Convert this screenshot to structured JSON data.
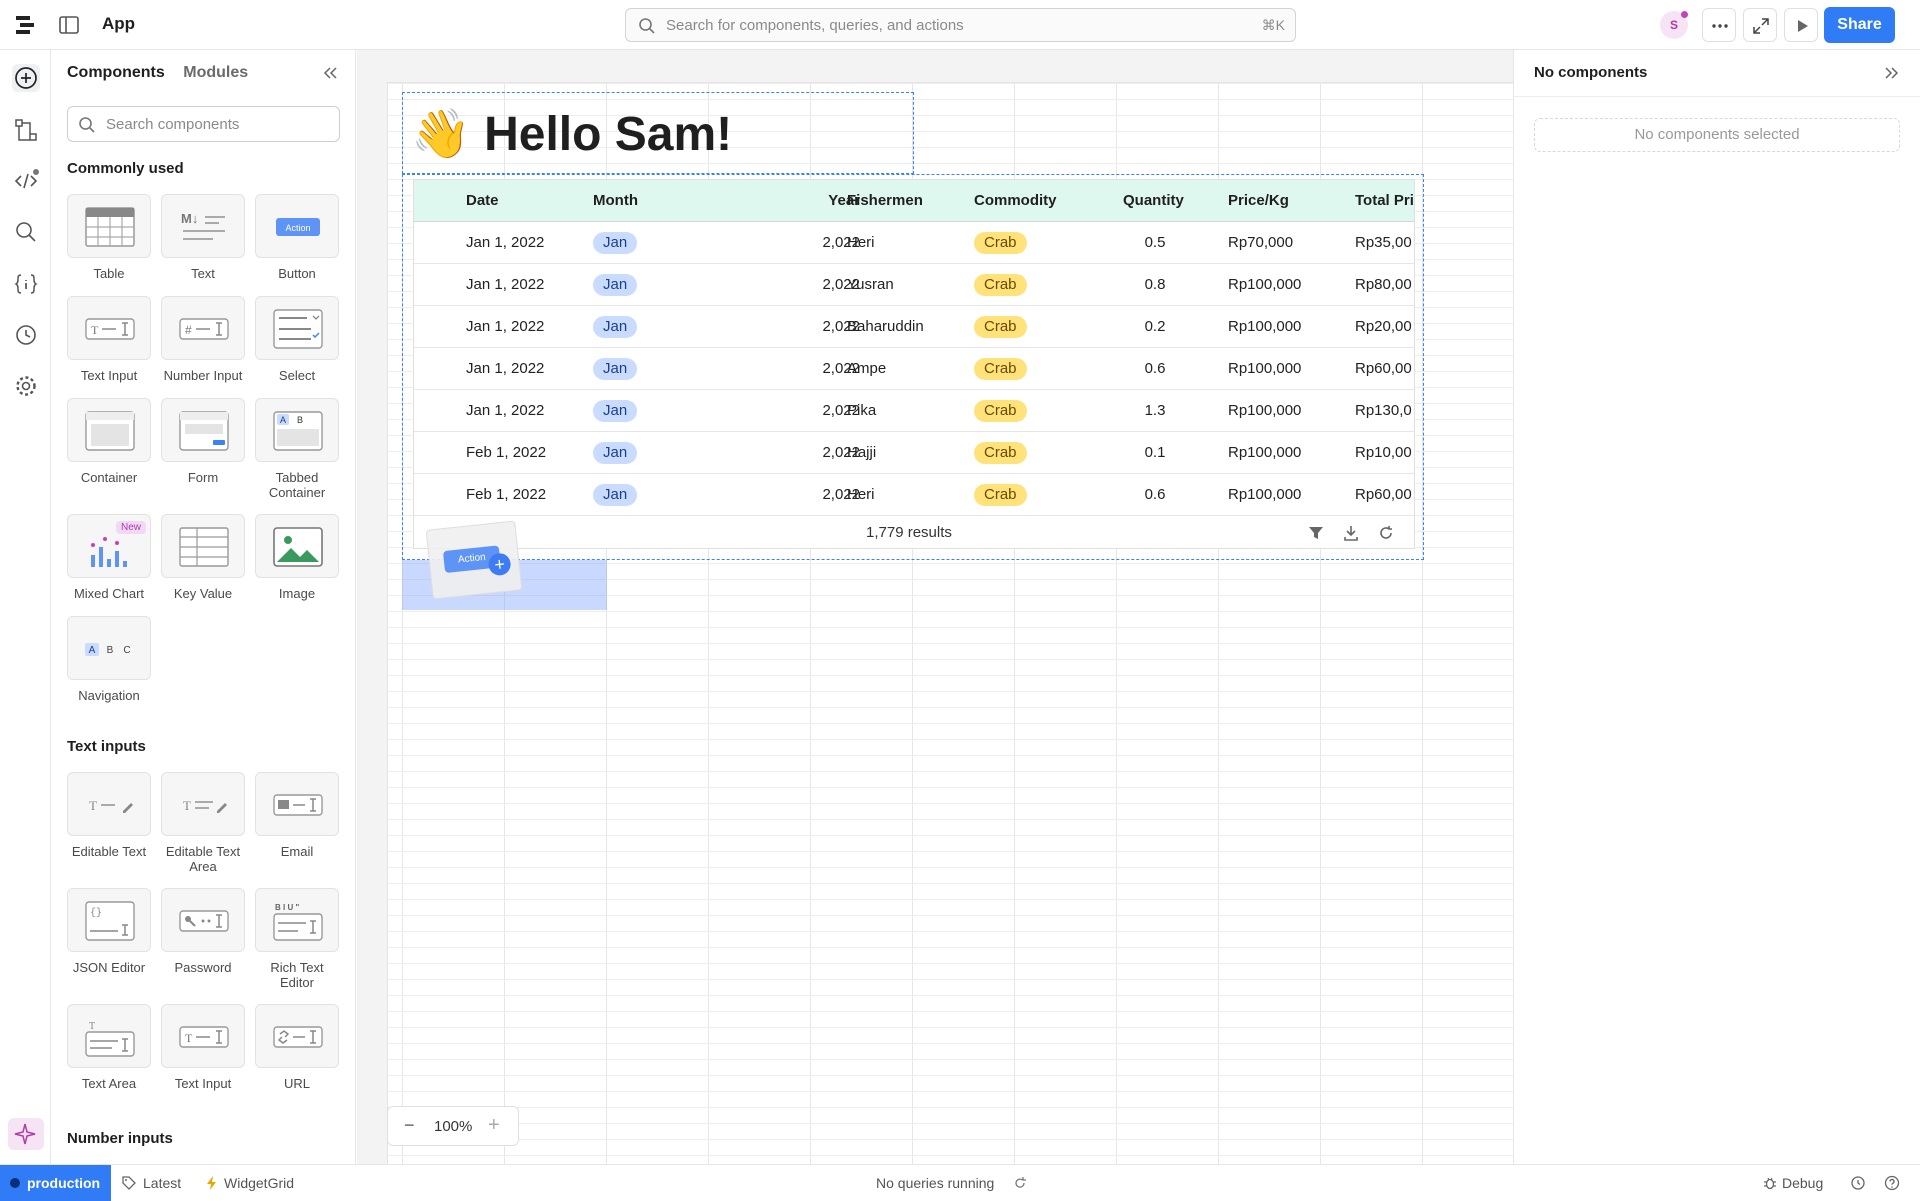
{
  "header": {
    "app_title": "App",
    "search_placeholder": "Search for components, queries, and actions",
    "search_shortcut": "⌘K",
    "avatar_initial": "S",
    "share_label": "Share"
  },
  "components_panel": {
    "tab_components": "Components",
    "tab_modules": "Modules",
    "search_placeholder": "Search components",
    "sections": {
      "commonly_used": "Commonly used",
      "text_inputs": "Text inputs",
      "number_inputs": "Number inputs"
    },
    "commonly_used": [
      {
        "label": "Table",
        "icon": "table-icon"
      },
      {
        "label": "Text",
        "icon": "markdown-text-icon"
      },
      {
        "label": "Button",
        "icon": "action-button-icon",
        "inner_label": "Action"
      },
      {
        "label": "Text Input",
        "icon": "text-input-icon"
      },
      {
        "label": "Number Input",
        "icon": "number-input-icon"
      },
      {
        "label": "Select",
        "icon": "select-icon"
      },
      {
        "label": "Container",
        "icon": "container-icon"
      },
      {
        "label": "Form",
        "icon": "form-icon"
      },
      {
        "label": "Tabbed Container",
        "icon": "tabbed-container-icon",
        "inner_a": "A",
        "inner_b": "B"
      },
      {
        "label": "Mixed Chart",
        "icon": "mixed-chart-icon",
        "badge": "New"
      },
      {
        "label": "Key Value",
        "icon": "key-value-icon"
      },
      {
        "label": "Image",
        "icon": "image-icon"
      },
      {
        "label": "Navigation",
        "icon": "navigation-icon",
        "inner_a": "A",
        "inner_b": "B",
        "inner_c": "C"
      }
    ],
    "text_inputs": [
      {
        "label": "Editable Text",
        "icon": "editable-text-icon"
      },
      {
        "label": "Editable Text Area",
        "icon": "editable-text-area-icon"
      },
      {
        "label": "Email",
        "icon": "email-icon"
      },
      {
        "label": "JSON Editor",
        "icon": "json-editor-icon"
      },
      {
        "label": "Password",
        "icon": "password-icon"
      },
      {
        "label": "Rich Text Editor",
        "icon": "rich-text-editor-icon"
      },
      {
        "label": "Text Area",
        "icon": "text-area-icon"
      },
      {
        "label": "Text Input",
        "icon": "text-input-icon"
      },
      {
        "label": "URL",
        "icon": "url-icon"
      }
    ]
  },
  "canvas": {
    "greeting": "👋 Hello Sam!",
    "table": {
      "columns": [
        "Date",
        "Month",
        "Year",
        "Fishermen",
        "Commodity",
        "Quantity",
        "Price/Kg",
        "Total Pri"
      ],
      "rows": [
        {
          "date": "Jan 1, 2022",
          "month": "Jan",
          "year": "2,022",
          "fisher": "Heri",
          "commodity": "Crab",
          "qty": "0.5",
          "price": "Rp70,000",
          "total": "Rp35,00"
        },
        {
          "date": "Jan 1, 2022",
          "month": "Jan",
          "year": "2,022",
          "fisher": "Yusran",
          "commodity": "Crab",
          "qty": "0.8",
          "price": "Rp100,000",
          "total": "Rp80,00"
        },
        {
          "date": "Jan 1, 2022",
          "month": "Jan",
          "year": "2,022",
          "fisher": "Baharuddin",
          "commodity": "Crab",
          "qty": "0.2",
          "price": "Rp100,000",
          "total": "Rp20,00"
        },
        {
          "date": "Jan 1, 2022",
          "month": "Jan",
          "year": "2,022",
          "fisher": "Ampe",
          "commodity": "Crab",
          "qty": "0.6",
          "price": "Rp100,000",
          "total": "Rp60,00"
        },
        {
          "date": "Jan 1, 2022",
          "month": "Jan",
          "year": "2,022",
          "fisher": "Pika",
          "commodity": "Crab",
          "qty": "1.3",
          "price": "Rp100,000",
          "total": "Rp130,0"
        },
        {
          "date": "Feb 1, 2022",
          "month": "Jan",
          "year": "2,022",
          "fisher": "Hajji",
          "commodity": "Crab",
          "qty": "0.1",
          "price": "Rp100,000",
          "total": "Rp10,00"
        },
        {
          "date": "Feb 1, 2022",
          "month": "Jan",
          "year": "2,022",
          "fisher": "Heri",
          "commodity": "Crab",
          "qty": "0.6",
          "price": "Rp100,000",
          "total": "Rp60,00"
        }
      ],
      "results": "1,779 results"
    },
    "drag_preview_label": "Action",
    "zoom": "100%"
  },
  "inspector": {
    "title": "No components",
    "empty": "No components selected"
  },
  "statusbar": {
    "environment": "production",
    "branch": "Latest",
    "widget": "WidgetGrid",
    "queries": "No queries running",
    "debug": "Debug"
  },
  "colors": {
    "accent": "#2f7cf6",
    "table_header": "#dff8ef",
    "month_pill": "#c9dcff",
    "commodity_pill": "#ffe27a"
  }
}
